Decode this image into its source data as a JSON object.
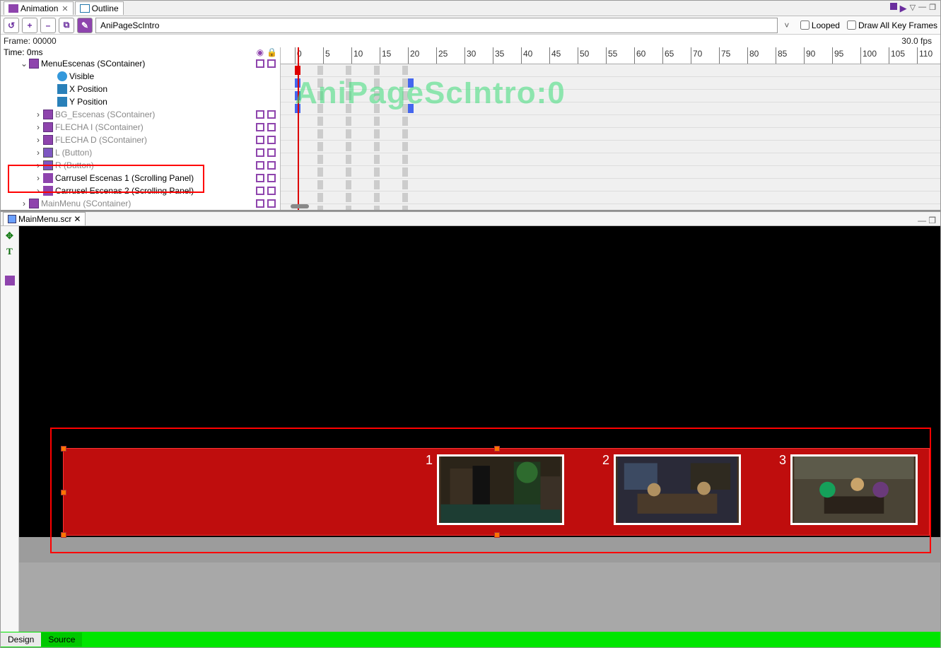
{
  "tabs": {
    "animation": "Animation",
    "outline": "Outline"
  },
  "toolbar": {
    "animation_name": "AniPageScIntro",
    "looped_label": "Looped",
    "draw_all_label": "Draw All Key Frames"
  },
  "status": {
    "frame_label": "Frame: 00000",
    "time_label": "Time:  0ms",
    "fps": "30.0 fps"
  },
  "tree": {
    "items": [
      {
        "label": "MenuEscenas (SContainer)",
        "indent": 26,
        "twisty": "⌄",
        "icon": "cont",
        "marks": true
      },
      {
        "label": "Visible",
        "indent": 66,
        "icon": "eye"
      },
      {
        "label": "X Position",
        "indent": 66,
        "icon": "x"
      },
      {
        "label": "Y Position",
        "indent": 66,
        "icon": "y"
      },
      {
        "label": "BG_Escenas (SContainer)",
        "indent": 46,
        "twisty": "›",
        "icon": "cont",
        "dim": true,
        "marks": true
      },
      {
        "label": "FLECHA I (SContainer)",
        "indent": 46,
        "twisty": "›",
        "icon": "cont",
        "dim": true,
        "marks": true
      },
      {
        "label": "FLECHA D (SContainer)",
        "indent": 46,
        "twisty": "›",
        "icon": "cont",
        "dim": true,
        "marks": true
      },
      {
        "label": "L (Button)",
        "indent": 46,
        "twisty": "›",
        "icon": "btn",
        "dim": true,
        "marks": true
      },
      {
        "label": "R (Button)",
        "indent": 46,
        "twisty": "›",
        "icon": "btn",
        "dim": true,
        "marks": true
      },
      {
        "label": "Carrusel Escenas 1 (Scrolling Panel)",
        "indent": 46,
        "twisty": "›",
        "icon": "scroll",
        "marks": true
      },
      {
        "label": "Carrusel Escenas 2 (Scrolling Panel)",
        "indent": 46,
        "twisty": "›",
        "icon": "scroll",
        "marks": true
      },
      {
        "label": "MainMenu (SContainer)",
        "indent": 26,
        "twisty": "›",
        "icon": "cont",
        "dim": true,
        "marks": true
      }
    ]
  },
  "timeline": {
    "ticks": [
      0,
      5,
      10,
      15,
      20,
      25,
      30,
      35,
      40,
      45,
      50,
      55,
      60,
      65,
      70,
      75,
      80,
      85,
      90,
      95,
      100,
      105,
      110
    ],
    "watermark": "AniPageScIntro:0"
  },
  "editor": {
    "filename": "MainMenu.scr"
  },
  "carousel": {
    "thumbs": [
      {
        "n": "1"
      },
      {
        "n": "2"
      },
      {
        "n": "3"
      }
    ]
  },
  "bottom_tabs": {
    "design": "Design",
    "source": "Source"
  }
}
